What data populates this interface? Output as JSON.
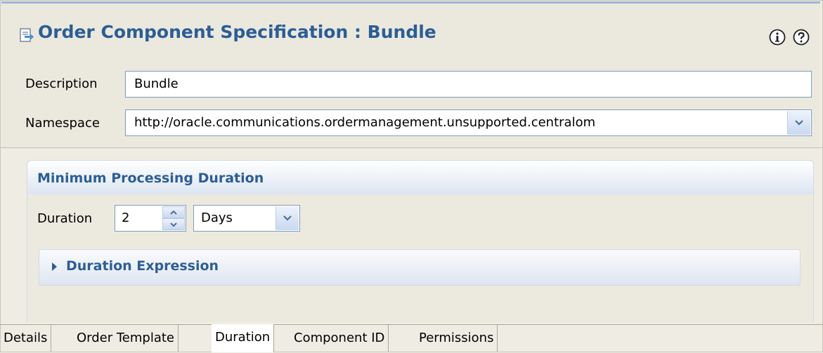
{
  "header": {
    "title": "Order Component Specification : Bundle",
    "info_icon": "info-icon",
    "help_icon": "help-icon"
  },
  "fields": {
    "description_label": "Description",
    "description_value": "Bundle",
    "namespace_label": "Namespace",
    "namespace_value": "http://oracle.communications.ordermanagement.unsupported.centralom"
  },
  "section": {
    "title": "Minimum Processing Duration",
    "duration_label": "Duration",
    "duration_value": "2",
    "unit_value": "Days",
    "expression_title": "Duration Expression"
  },
  "tabs": [
    {
      "label": "Details"
    },
    {
      "label": "Order Template"
    },
    {
      "label": "Duration",
      "active": true
    },
    {
      "label": "Component ID"
    },
    {
      "label": "Permissions"
    }
  ],
  "colors": {
    "accent": "#2c5e95",
    "background": "#efece3"
  }
}
